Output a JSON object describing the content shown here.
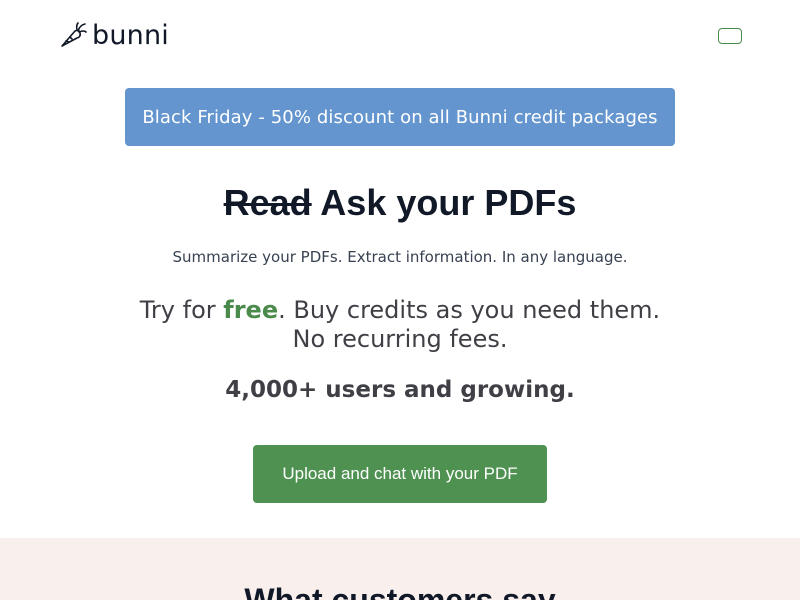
{
  "header": {
    "logo_text": "bunni",
    "logo_icon": "carrot-icon",
    "menu_icon": "menu-toggle-icon"
  },
  "promo": {
    "text": "Black Friday - 50% discount on all Bunni credit packages"
  },
  "hero": {
    "title_struck": "Read",
    "title_rest": " Ask your PDFs",
    "subtitle": "Summarize your PDFs. Extract information. In any language.",
    "tagline_before": "Try for ",
    "tagline_free": "free",
    "tagline_after": ". Buy credits as you need them. No recurring fees.",
    "users": "4,000+ users and growing.",
    "cta_label": "Upload and chat with your PDF"
  },
  "customers": {
    "title": "What customers say"
  },
  "colors": {
    "promo_bg": "#6495cf",
    "cta_bg": "#4e9150",
    "free_accent": "#4a8a4a",
    "section_bg": "#f9f0ed"
  }
}
